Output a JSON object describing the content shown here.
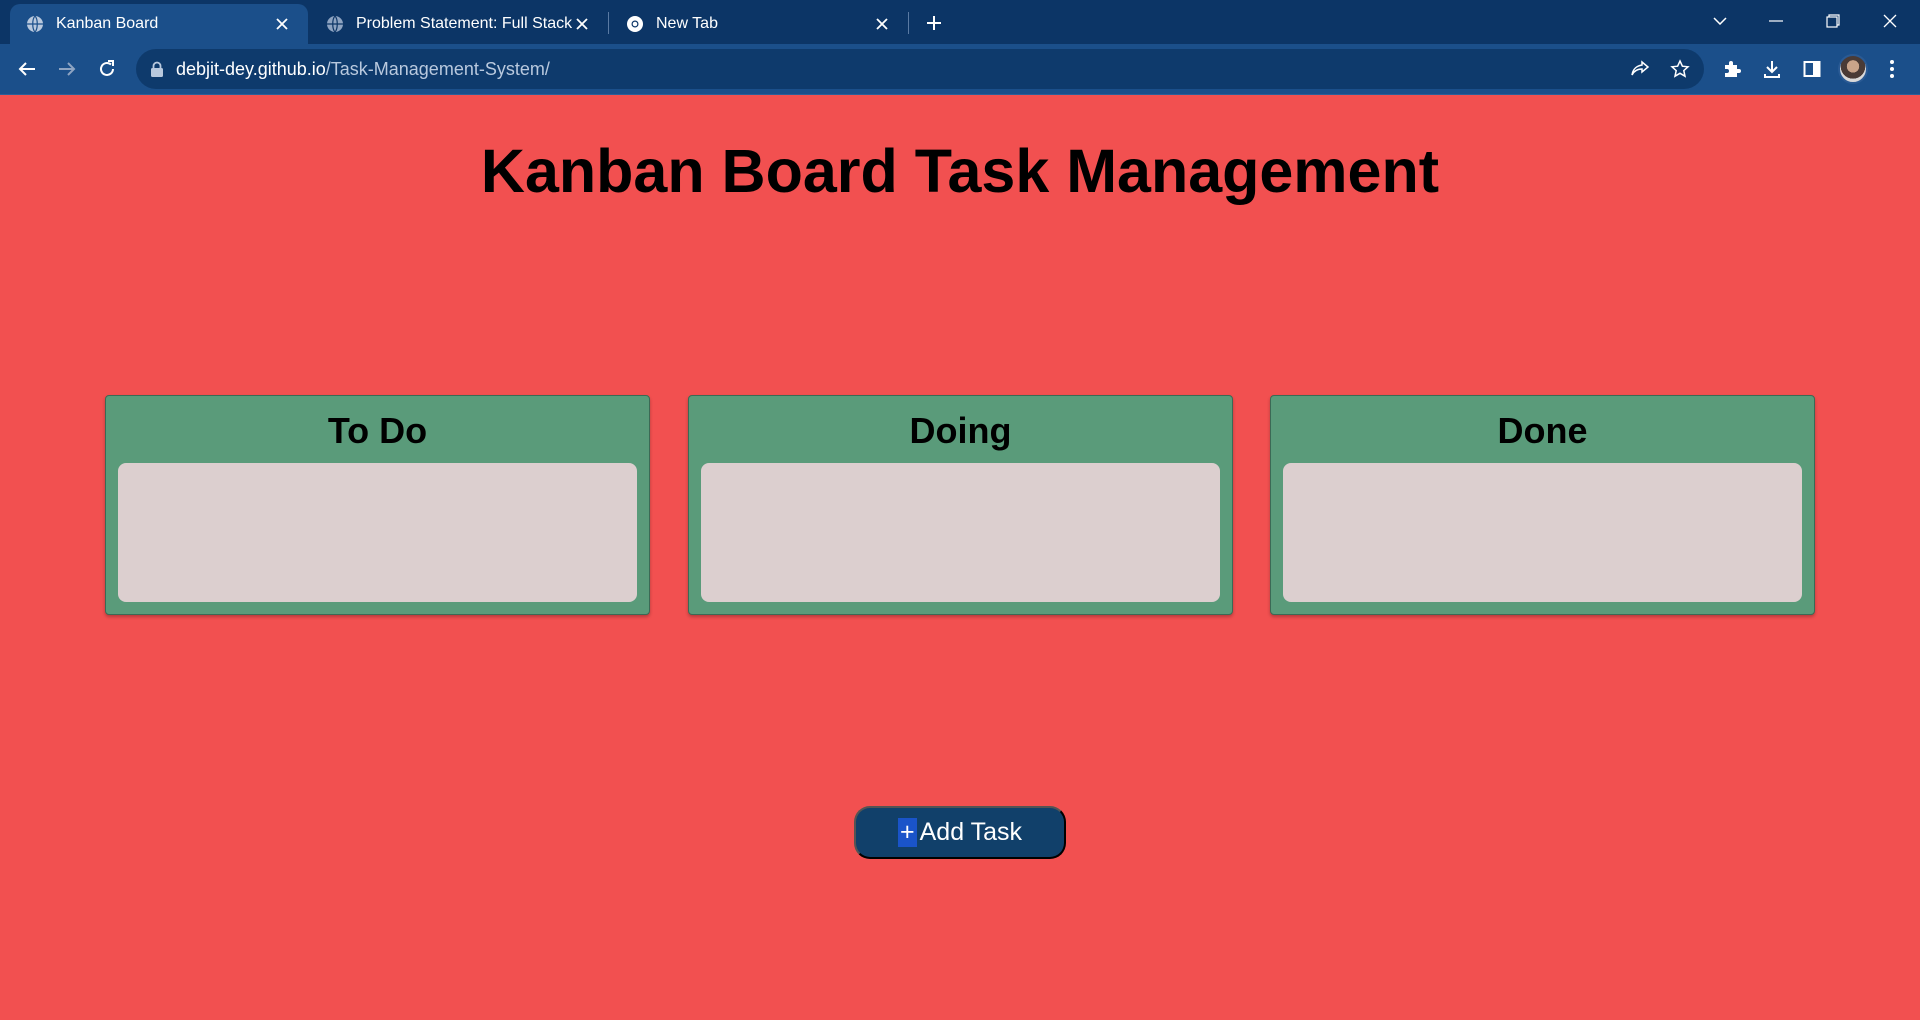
{
  "browser": {
    "tabs": [
      {
        "title": "Kanban Board",
        "icon": "globe-icon",
        "active": true
      },
      {
        "title": "Problem Statement: Full Stack De",
        "icon": "globe-icon",
        "active": false
      },
      {
        "title": "New Tab",
        "icon": "chrome-icon",
        "active": false
      }
    ],
    "address": {
      "domain": "debjit-dey.github.io",
      "path": "/Task-Management-System/"
    },
    "colors": {
      "tabstrip": "#0c3566",
      "toolbar": "#1b4f8a",
      "omnibox": "#0e3a6c"
    }
  },
  "page": {
    "title": "Kanban Board Task Management",
    "background": "#f25050",
    "columns": [
      {
        "title": "To Do",
        "tasks": []
      },
      {
        "title": "Doing",
        "tasks": []
      },
      {
        "title": "Done",
        "tasks": []
      }
    ],
    "add_button": {
      "plus": "+",
      "label": "Add Task"
    },
    "colors": {
      "column": "#5a9b7a",
      "dropzone": "#dccfcf",
      "button": "#11406a"
    }
  }
}
